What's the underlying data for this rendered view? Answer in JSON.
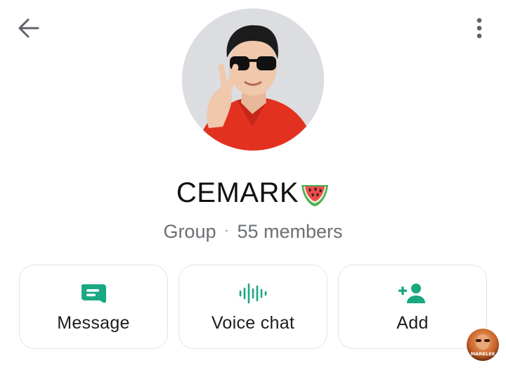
{
  "header": {
    "back_icon": "arrow-left-icon",
    "more_icon": "more-vertical-icon"
  },
  "group": {
    "name": "CEMARK",
    "name_emoji": "watermelon",
    "type_label": "Group",
    "separator": "·",
    "members_label": "55 members"
  },
  "actions": [
    {
      "label": "Message",
      "icon": "message-icon"
    },
    {
      "label": "Voice chat",
      "icon": "voice-wave-icon"
    },
    {
      "label": "Add",
      "icon": "add-person-icon"
    }
  ],
  "watermark": {
    "text": "MARKLEE"
  },
  "colors": {
    "accent": "#1aa882",
    "text_primary": "#111111",
    "text_secondary": "#6b6f73",
    "card_border": "#e3e4e6",
    "icon_gray": "#5f6368"
  }
}
